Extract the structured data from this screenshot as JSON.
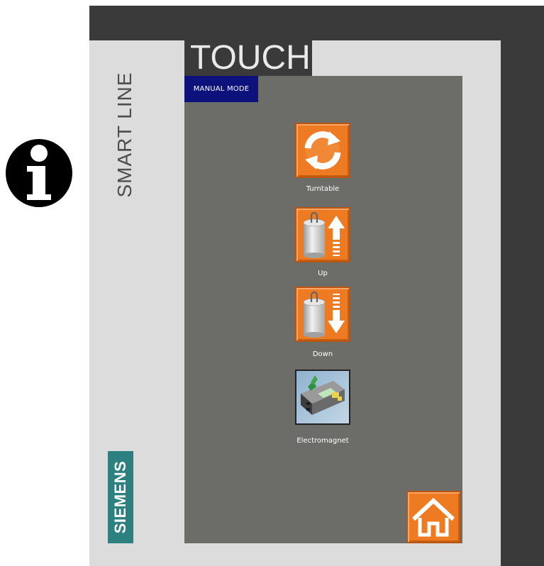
{
  "brand": {
    "product": "TOUCH",
    "series": "SMART LINE",
    "manufacturer": "SIEMENS"
  },
  "screen": {
    "mode_label": "MANUAL MODE",
    "buttons": [
      {
        "label": "Turntable",
        "icon": "rotate-arrows-icon"
      },
      {
        "label": "Up",
        "icon": "cylinder-up-icon"
      },
      {
        "label": "Down",
        "icon": "cylinder-down-icon"
      },
      {
        "label": "Electromagnet",
        "icon": "electromagnet-machine-icon"
      }
    ],
    "home_icon": "home-icon"
  },
  "colors": {
    "accent_orange": "#ee7a22",
    "mode_badge": "#0c117b",
    "screen_bg": "#6c6d69",
    "siemens_teal": "#2d8080"
  }
}
